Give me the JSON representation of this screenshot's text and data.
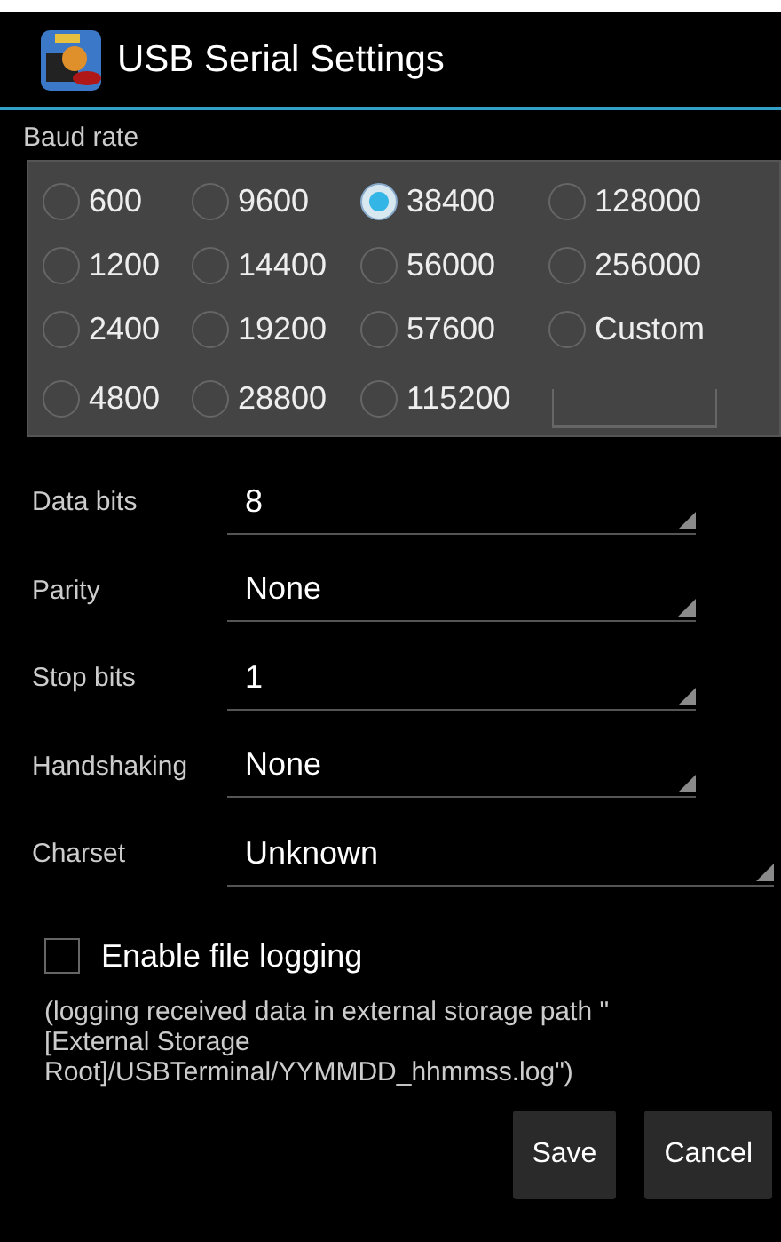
{
  "window": {
    "title": "USB Serial Settings"
  },
  "baud_rate": {
    "label": "Baud rate",
    "options": [
      {
        "label": "600",
        "selected": false
      },
      {
        "label": "9600",
        "selected": false
      },
      {
        "label": "38400",
        "selected": true
      },
      {
        "label": "128000",
        "selected": false
      },
      {
        "label": "1200",
        "selected": false
      },
      {
        "label": "14400",
        "selected": false
      },
      {
        "label": "56000",
        "selected": false
      },
      {
        "label": "256000",
        "selected": false
      },
      {
        "label": "2400",
        "selected": false
      },
      {
        "label": "19200",
        "selected": false
      },
      {
        "label": "57600",
        "selected": false
      },
      {
        "label": "Custom",
        "selected": false
      },
      {
        "label": "4800",
        "selected": false
      },
      {
        "label": "28800",
        "selected": false
      },
      {
        "label": "115200",
        "selected": false
      }
    ]
  },
  "settings": [
    {
      "label": "Data bits",
      "value": "8",
      "wide": false
    },
    {
      "label": "Parity",
      "value": "None",
      "wide": false
    },
    {
      "label": "Stop bits",
      "value": "1",
      "wide": false
    },
    {
      "label": "Handshaking",
      "value": "None",
      "wide": false
    },
    {
      "label": "Charset",
      "value": "Unknown",
      "wide": true
    }
  ],
  "file_logging": {
    "label": "Enable file logging",
    "checked": false,
    "note": "(logging received data in external storage path \"[External Storage Root]/USBTerminal/YYMMDD_hhmmss.log\")"
  },
  "buttons": [
    "Save",
    "Cancel"
  ]
}
